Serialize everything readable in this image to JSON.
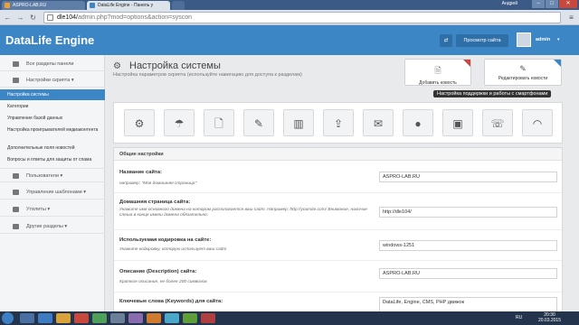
{
  "browser": {
    "tabs": [
      {
        "title": "ASPRO-LAB.RU"
      },
      {
        "title": "DataLife Engine - Панель у"
      },
      {
        "title": ""
      }
    ],
    "user": "Андрей",
    "url_host": "dle104/",
    "url_path": "admin.php?mod=options&action=syscon"
  },
  "header": {
    "brand": "DataLife Engine",
    "view_site": "Просмотр сайта",
    "user": "admin"
  },
  "sidebar": {
    "all_sections": "Все разделы панели",
    "script_settings": "Настройки скрипта",
    "sub": [
      "Настройка системы",
      "Категории",
      "Управление базой данных",
      "Настройка проигрывателей медиаконтента",
      "Дополнительные поля новостей",
      "Вопросы и ответы для защиты от спама"
    ],
    "users": "Пользователи",
    "templates": "Управление шаблонами",
    "utilities": "Утилиты",
    "other": "Другие разделы"
  },
  "page": {
    "title": "Настройка системы",
    "subtitle": "Настройка параметров скрипта (используйте навигацию для доступа к разделам)",
    "add_news": "Добавить новость",
    "edit_news": "Редактировать новости",
    "tooltip": "Настройка поддержки и работы с смартфонами"
  },
  "icon_row": [
    "gear-icon",
    "umbrella-icon",
    "document-icon",
    "pencil-icon",
    "chart-icon",
    "upload-icon",
    "mail-icon",
    "user-icon",
    "image-icon",
    "phone-icon",
    "rss-icon"
  ],
  "settings": {
    "header": "Общие настройки",
    "rows": [
      {
        "label": "Название сайта:",
        "desc": "например: \"Моя домашняя страница\"",
        "value": "ASPRO-LAB.RU"
      },
      {
        "label": "Домашняя страница сайта:",
        "desc": "Укажите имя основного домена на котором располагается ваш сайт. Например: http://yoursite.com/ Внимание, наличие слеша в конце имени домена обязательно.",
        "value": "http://dle104/"
      },
      {
        "label": "Используемая кодировка на сайте:",
        "desc": "Укажите кодировку, которую использует ваш сайт",
        "value": "windows-1251"
      },
      {
        "label": "Описание (Description) сайта:",
        "desc": "Краткое описание, не более 200 символов",
        "value": "ASPRO-LAB.RU"
      },
      {
        "label": "Ключевые слова (Keywords) для сайта:",
        "desc": "",
        "value": "DataLife, Engine, CMS, PHP движок"
      }
    ]
  },
  "taskbar": {
    "lang": "RU",
    "time": "20:30",
    "date": "20.03.2015"
  },
  "colors": {
    "brand_blue": "#3d86c6",
    "accent_red": "#c9483e"
  }
}
